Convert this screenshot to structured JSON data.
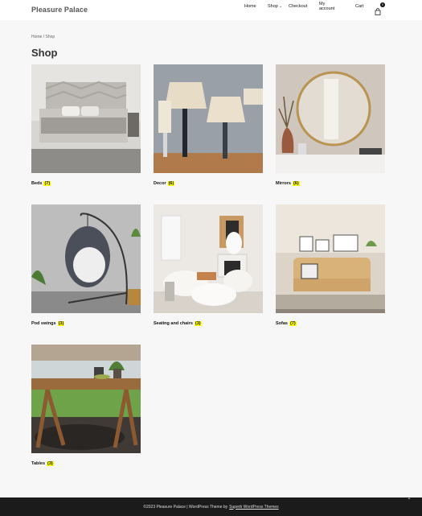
{
  "site": {
    "title": "Pleasure Palace"
  },
  "nav": {
    "home": "Home",
    "shop": "Shop",
    "checkout": "Checkout",
    "account": "My account",
    "cart": "Cart",
    "cart_count": "0"
  },
  "breadcrumb": {
    "home": "Home",
    "sep": " / ",
    "current": "Shop"
  },
  "page": {
    "title": "Shop"
  },
  "categories": [
    {
      "name": "Beds",
      "count": "(7)"
    },
    {
      "name": "Decor",
      "count": "(6)"
    },
    {
      "name": "Mirrors",
      "count": "(6)"
    },
    {
      "name": "Pod swings",
      "count": "(3)"
    },
    {
      "name": "Seating and chairs",
      "count": "(3)"
    },
    {
      "name": "Sofas",
      "count": "(7)"
    },
    {
      "name": "Tables",
      "count": "(3)"
    }
  ],
  "footer": {
    "text": "©2023 Pleasure Palace | WordPress Theme by",
    "link": "Superb WordPress Themes"
  },
  "colors": {
    "highlight": "#ffff00",
    "footer_bg": "#1b1b1b"
  }
}
